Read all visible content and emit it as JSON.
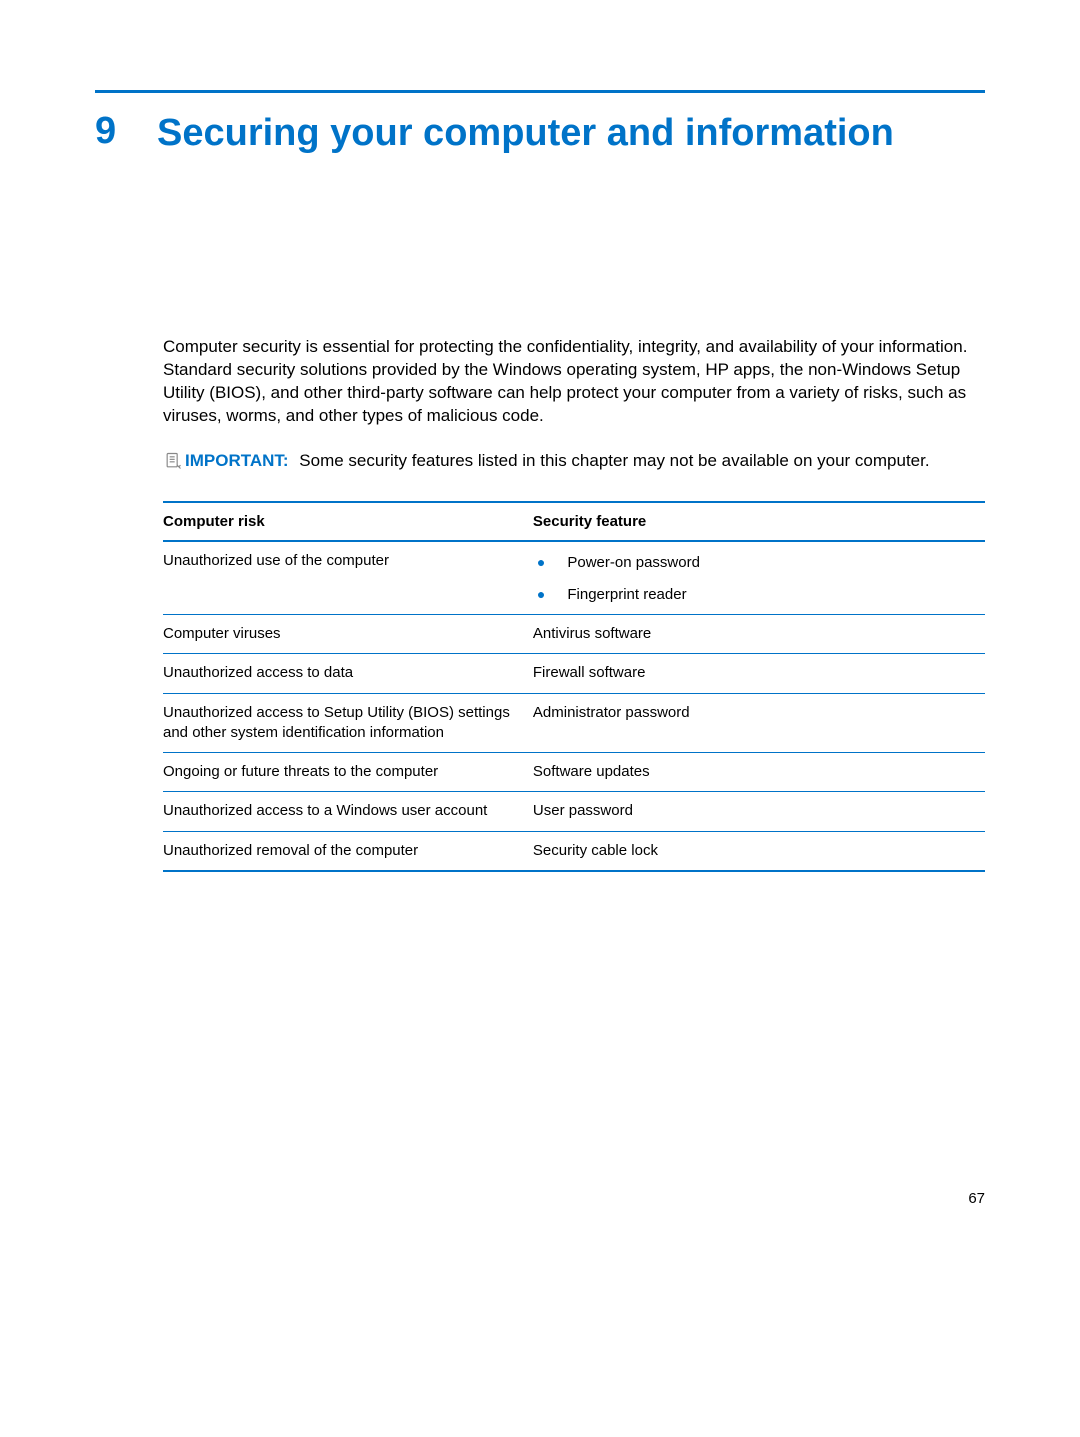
{
  "chapter": {
    "number": "9",
    "title": "Securing your computer and information"
  },
  "intro_paragraph": "Computer security is essential for protecting the confidentiality, integrity, and availability of your information. Standard security solutions provided by the Windows operating system, HP apps, the non-Windows Setup Utility (BIOS), and other third-party software can help protect your computer from a variety of risks, such as viruses, worms, and other types of malicious code.",
  "note": {
    "label": "IMPORTANT:",
    "text": "Some security features listed in this chapter may not be available on your computer."
  },
  "table": {
    "headers": {
      "risk": "Computer risk",
      "feature": "Security feature"
    },
    "rows": [
      {
        "risk": "Unauthorized use of the computer",
        "features": [
          "Power-on password",
          "Fingerprint reader"
        ],
        "list": true
      },
      {
        "risk": "Computer viruses",
        "features": [
          "Antivirus software"
        ],
        "list": false
      },
      {
        "risk": "Unauthorized access to data",
        "features": [
          "Firewall software"
        ],
        "list": false
      },
      {
        "risk": "Unauthorized access to Setup Utility (BIOS) settings and other system identification information",
        "features": [
          "Administrator password"
        ],
        "list": false
      },
      {
        "risk": "Ongoing or future threats to the computer",
        "features": [
          "Software updates"
        ],
        "list": false
      },
      {
        "risk": "Unauthorized access to a Windows user account",
        "features": [
          "User password"
        ],
        "list": false
      },
      {
        "risk": "Unauthorized removal of the computer",
        "features": [
          "Security cable lock"
        ],
        "list": false
      }
    ]
  },
  "page_number": "67"
}
